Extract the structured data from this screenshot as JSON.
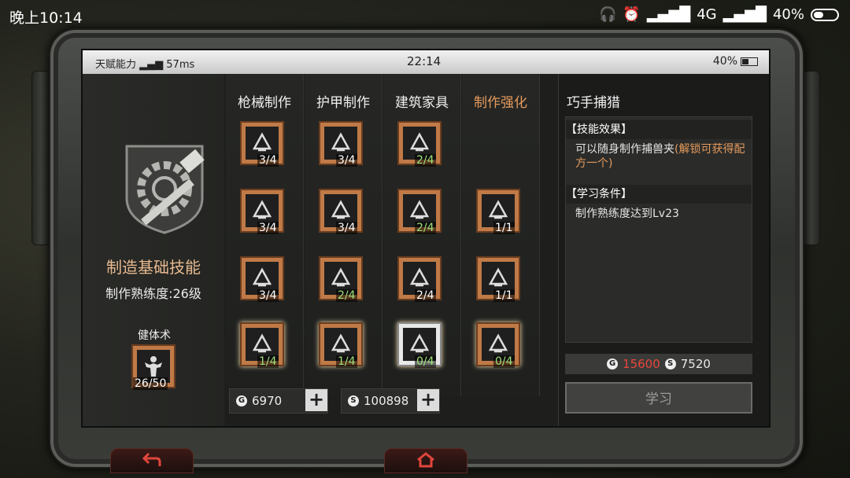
{
  "android_status": {
    "time": "晚上10:14",
    "network": "4G",
    "battery": "40%"
  },
  "game_status": {
    "signal_label": "天赋能力",
    "ping": "57ms",
    "clock": "22:14",
    "battery": "40%"
  },
  "left_panel": {
    "title": "制造基础技能",
    "level": "制作熟练度:26级",
    "fitness": {
      "label": "健体术",
      "count": "26/50"
    }
  },
  "tabs": [
    "枪械制作",
    "护甲制作",
    "建筑家具",
    "制作强化"
  ],
  "active_tab": "制作强化",
  "grid": [
    [
      {
        "count": "3/4",
        "style": "done",
        "icon": "rifle-workbench-icon"
      },
      {
        "count": "3/4",
        "style": "done",
        "icon": "armor-craft-icon"
      },
      {
        "count": "2/4",
        "style": "green",
        "icon": "furniture-craft-icon"
      },
      null
    ],
    [
      {
        "count": "3/4",
        "style": "done",
        "icon": "pistol-craft-icon"
      },
      {
        "count": "3/4",
        "style": "done",
        "icon": "glove-craft-icon"
      },
      {
        "count": "2/4",
        "style": "green",
        "icon": "wall-build-icon"
      },
      {
        "count": "1/1",
        "style": "done",
        "icon": "fire-forge-icon"
      }
    ],
    [
      {
        "count": "3/4",
        "style": "done",
        "icon": "crossbow-craft-icon"
      },
      {
        "count": "2/4",
        "style": "green",
        "icon": "blade-craft-icon"
      },
      {
        "count": "2/4",
        "style": "done",
        "icon": "door-build-icon"
      },
      {
        "count": "1/1",
        "style": "done",
        "icon": "pliers-icon"
      }
    ],
    [
      {
        "count": "1/4",
        "style": "green",
        "icon": "knife-craft-icon"
      },
      {
        "count": "1/4",
        "style": "green",
        "icon": "shield-craft-icon"
      },
      {
        "count": "0/4",
        "style": "green",
        "icon": "brick-wall-icon"
      },
      {
        "count": "0/4",
        "style": "green",
        "icon": "trap-icon"
      }
    ]
  ],
  "currency": {
    "gold": "6970",
    "silver": "100898"
  },
  "detail": {
    "title": "巧手捕猎",
    "effect_header": "【技能效果】",
    "effect_text": "可以随身制作捕兽夹",
    "effect_highlight": "(解锁可获得配方一个)",
    "cond_header": "【学习条件】",
    "cond_text": "制作熟练度达到Lv23",
    "cost_gold": "15600",
    "cost_silver": "7520",
    "learn_label": "学习"
  },
  "colors": {
    "accent": "#e59a5c",
    "tile": "#c07a47",
    "green": "#9ee07a",
    "red": "#e8453c"
  }
}
